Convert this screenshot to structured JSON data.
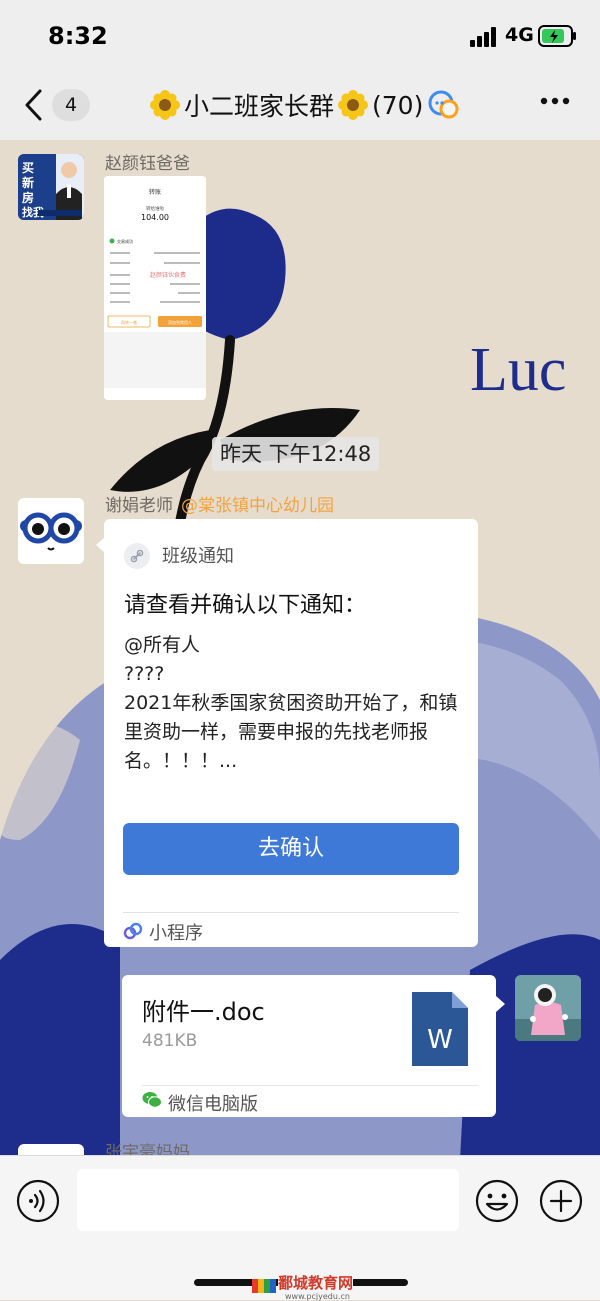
{
  "status_bar": {
    "time": "8:32",
    "network": "4G"
  },
  "nav": {
    "unread_count": "4",
    "title": "小二班家长群",
    "member_count": "(70)"
  },
  "messages": [
    {
      "sender": "赵颜钰爸爸",
      "avatar_text": "买新房找我",
      "type": "image",
      "image": {
        "header": "转账",
        "subheader": "转给谁啦",
        "amount": "104.00",
        "status": "交易成功",
        "stamp": "赵颜钰伙食费",
        "btn1": "再转一笔",
        "btn2": "添加到常用人"
      }
    },
    {
      "time_divider": "昨天 下午12:48"
    },
    {
      "sender": "谢娟老师",
      "org": "@棠张镇中心幼儿园",
      "type": "card",
      "card": {
        "source": "班级通知",
        "heading": "请查看并确认以下通知：",
        "line1": "@所有人",
        "line2": "????",
        "line3": "2021年秋季国家贫困资助开始了，和镇里资助一样，需要申报的先找老师报名。！！！...",
        "button": "去确认",
        "footer": "小程序"
      }
    },
    {
      "sender": "self",
      "type": "file",
      "file": {
        "name": "附件一.doc",
        "size": "481KB",
        "source": "微信电脑版",
        "icon_letter": "W"
      }
    },
    {
      "sender": "张宇豪妈妈"
    }
  ],
  "wallpaper_text": "Luc",
  "input": {
    "placeholder": ""
  },
  "watermark": {
    "text": "鄱城教育网",
    "url": "www.pcjyedu.cn"
  },
  "icons": {
    "back": "back-icon",
    "more": "more-icon",
    "voice": "voice-icon",
    "emoji": "emoji-icon",
    "add": "add-icon",
    "word": "word-doc-icon"
  },
  "colors": {
    "confirm_button": "#3f79d7",
    "org_label": "#f2a340",
    "word_icon": "#2b5797",
    "wallpaper_navy": "#1e2d8c",
    "wallpaper_periwinkle": "#8d98c8"
  }
}
